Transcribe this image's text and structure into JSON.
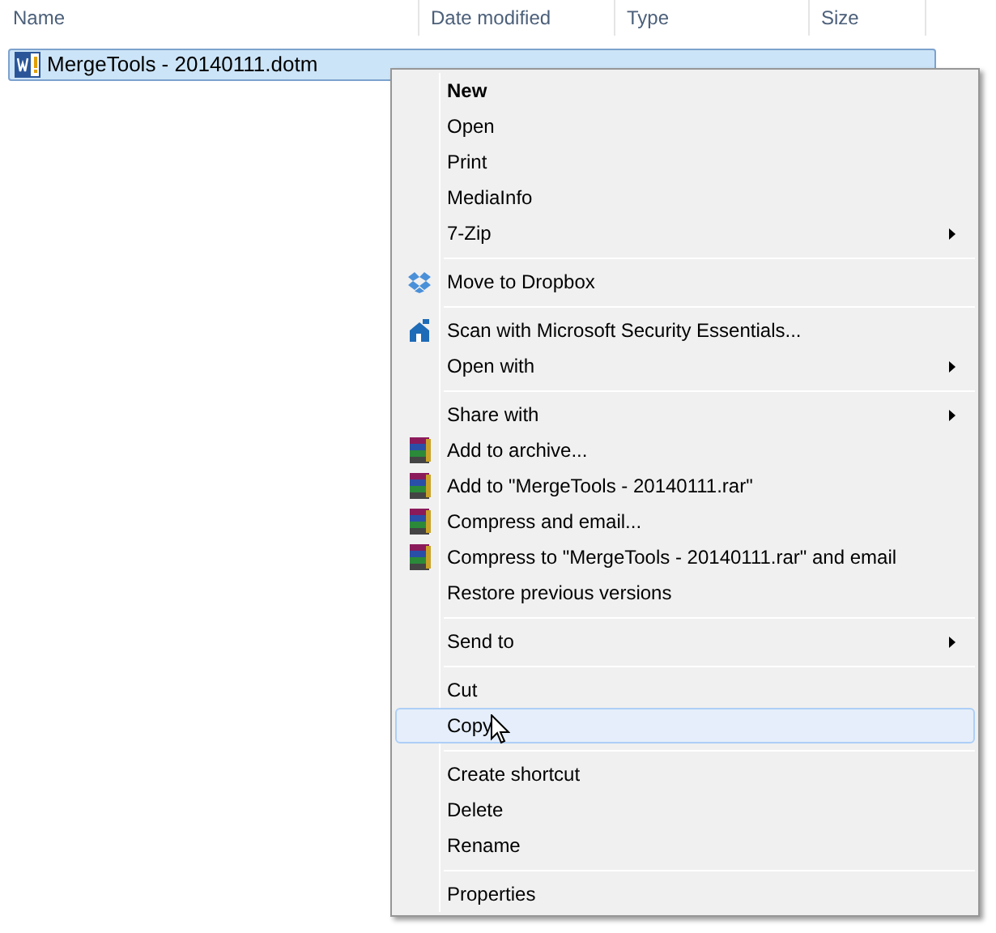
{
  "columns": [
    {
      "label": "Name"
    },
    {
      "label": "Date modified"
    },
    {
      "label": "Type"
    },
    {
      "label": "Size"
    }
  ],
  "file": {
    "name": "MergeTools - 20140111.dotm",
    "selected": true
  },
  "menu": [
    {
      "kind": "plain",
      "label": "New",
      "bold": true,
      "submenu": false,
      "selected": false
    },
    {
      "kind": "plain",
      "label": "Open",
      "bold": false,
      "submenu": false,
      "selected": false
    },
    {
      "kind": "plain",
      "label": "Print",
      "bold": false,
      "submenu": false,
      "selected": false
    },
    {
      "kind": "plain",
      "label": "MediaInfo",
      "bold": false,
      "submenu": false,
      "selected": false
    },
    {
      "kind": "plain",
      "label": "7-Zip",
      "bold": false,
      "submenu": true,
      "selected": false
    },
    {
      "kind": "separator"
    },
    {
      "kind": "dropbox",
      "label": "Move to Dropbox",
      "bold": false,
      "submenu": false,
      "selected": false
    },
    {
      "kind": "separator"
    },
    {
      "kind": "security",
      "label": "Scan with Microsoft Security Essentials...",
      "bold": false,
      "submenu": false,
      "selected": false
    },
    {
      "kind": "plain",
      "label": "Open with",
      "bold": false,
      "submenu": true,
      "selected": false
    },
    {
      "kind": "separator"
    },
    {
      "kind": "plain",
      "label": "Share with",
      "bold": false,
      "submenu": true,
      "selected": false
    },
    {
      "kind": "archive",
      "label": "Add to archive...",
      "bold": false,
      "submenu": false,
      "selected": false
    },
    {
      "kind": "archive",
      "label": "Add to \"MergeTools - 20140111.rar\"",
      "bold": false,
      "submenu": false,
      "selected": false
    },
    {
      "kind": "archive",
      "label": "Compress and email...",
      "bold": false,
      "submenu": false,
      "selected": false
    },
    {
      "kind": "archive",
      "label": "Compress to \"MergeTools - 20140111.rar\" and email",
      "bold": false,
      "submenu": false,
      "selected": false
    },
    {
      "kind": "plain",
      "label": "Restore previous versions",
      "bold": false,
      "submenu": false,
      "selected": false
    },
    {
      "kind": "separator"
    },
    {
      "kind": "plain",
      "label": "Send to",
      "bold": false,
      "submenu": true,
      "selected": false
    },
    {
      "kind": "separator"
    },
    {
      "kind": "plain",
      "label": "Cut",
      "bold": false,
      "submenu": false,
      "selected": false
    },
    {
      "kind": "plain",
      "label": "Copy",
      "bold": false,
      "submenu": false,
      "selected": true
    },
    {
      "kind": "separator"
    },
    {
      "kind": "plain",
      "label": "Create shortcut",
      "bold": false,
      "submenu": false,
      "selected": false
    },
    {
      "kind": "plain",
      "label": "Delete",
      "bold": false,
      "submenu": false,
      "selected": false
    },
    {
      "kind": "plain",
      "label": "Rename",
      "bold": false,
      "submenu": false,
      "selected": false
    },
    {
      "kind": "separator"
    },
    {
      "kind": "plain",
      "label": "Properties",
      "bold": false,
      "submenu": false,
      "selected": false
    }
  ]
}
